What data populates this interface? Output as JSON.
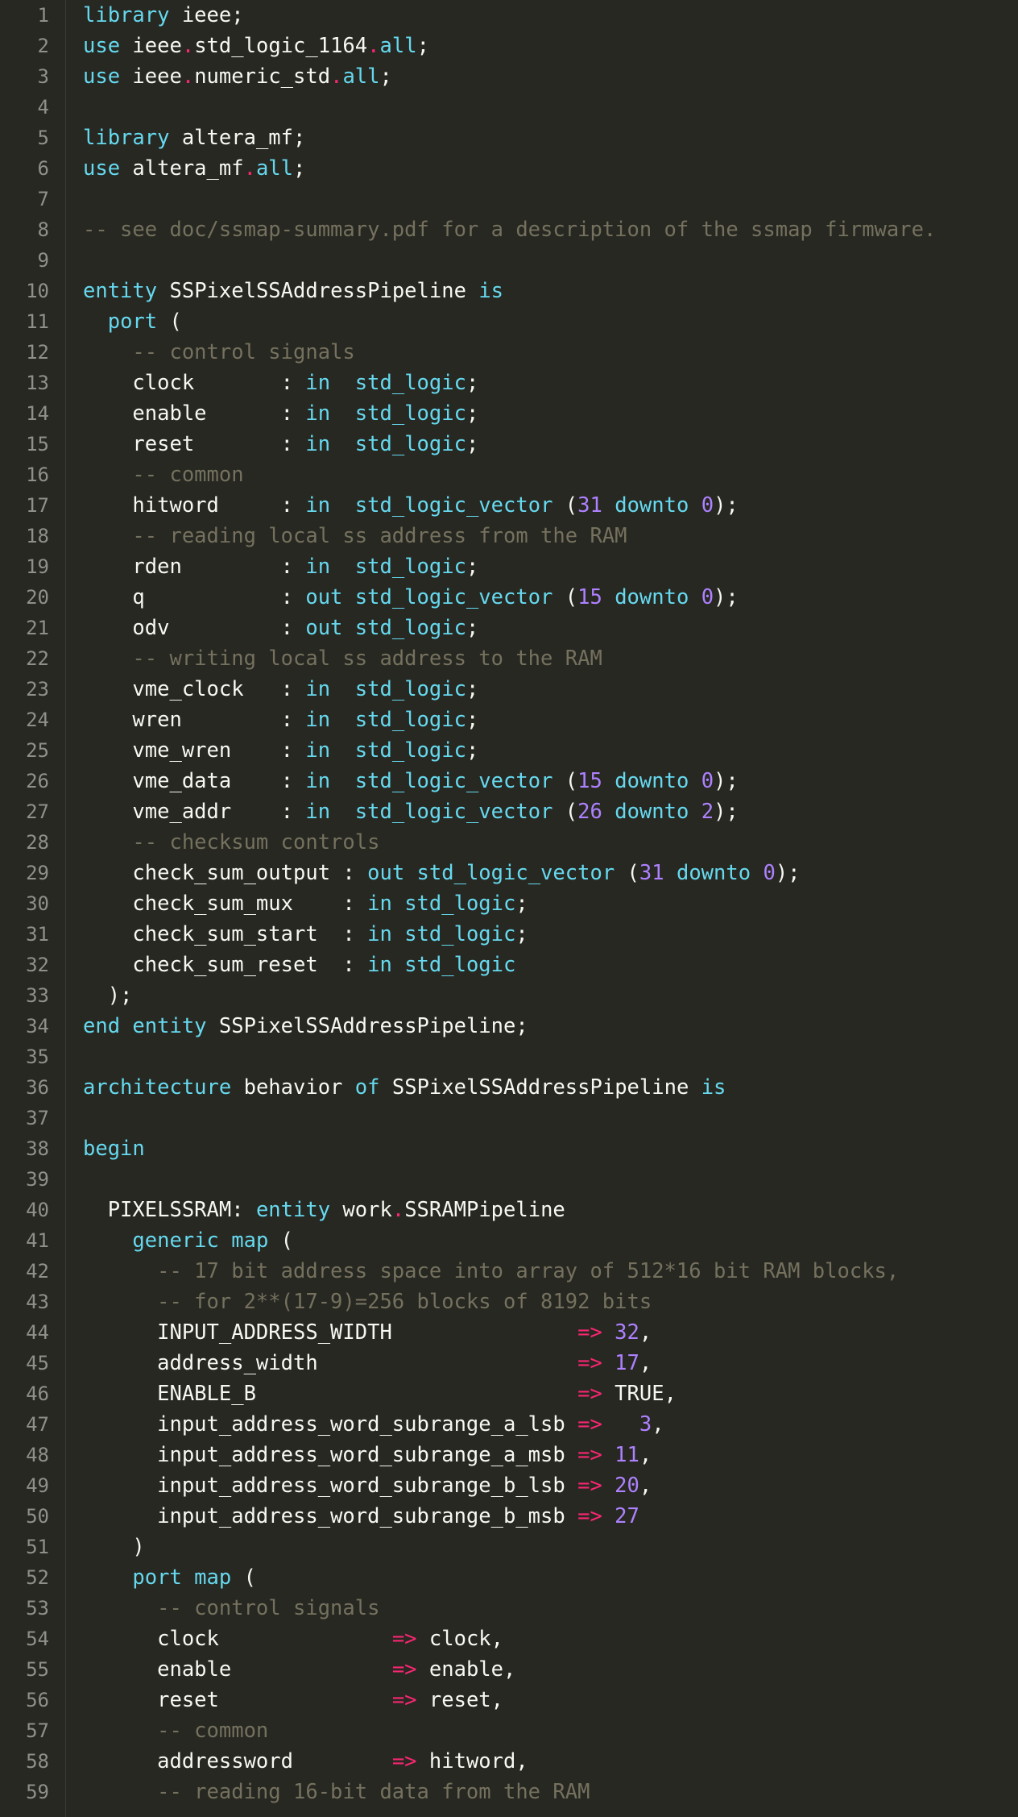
{
  "editor": {
    "colors": {
      "background": "#272822",
      "text": "#f8f8f2",
      "keyword": "#66d9ef",
      "operator": "#f92672",
      "number": "#ae81ff",
      "comment": "#75715e",
      "line_number": "#8f908a"
    },
    "lines": [
      [
        [
          "kw",
          "library"
        ],
        [
          "",
          "ieee;"
        ]
      ],
      [
        [
          "kw",
          "use"
        ],
        [
          "",
          "ieee"
        ],
        [
          "op",
          "."
        ],
        [
          "",
          "std_logic_1164"
        ],
        [
          "op",
          "."
        ],
        [
          "kw",
          "all"
        ],
        [
          "",
          ";"
        ]
      ],
      [
        [
          "kw",
          "use"
        ],
        [
          "",
          "ieee"
        ],
        [
          "op",
          "."
        ],
        [
          "",
          "numeric_std"
        ],
        [
          "op",
          "."
        ],
        [
          "kw",
          "all"
        ],
        [
          "",
          ";"
        ]
      ],
      [],
      [
        [
          "kw",
          "library"
        ],
        [
          "",
          "altera_mf;"
        ]
      ],
      [
        [
          "kw",
          "use"
        ],
        [
          "",
          "altera_mf"
        ],
        [
          "op",
          "."
        ],
        [
          "kw",
          "all"
        ],
        [
          "",
          ";"
        ]
      ],
      [],
      [
        [
          "cm",
          "-- see doc/ssmap-summary.pdf for a description of the ssmap firmware."
        ]
      ],
      [],
      [
        [
          "kw",
          "entity"
        ],
        [
          "",
          "SSPixelSSAddressPipeline"
        ],
        [
          "kw",
          "is"
        ]
      ],
      [
        [
          "",
          "  "
        ],
        [
          "kw",
          "port"
        ],
        [
          "",
          "("
        ]
      ],
      [
        [
          "cm",
          "    -- control signals"
        ]
      ],
      [
        [
          "",
          "    clock       : "
        ],
        [
          "kw",
          "in"
        ],
        [
          "",
          "  "
        ],
        [
          "kw",
          "std_logic"
        ],
        [
          "",
          ";"
        ]
      ],
      [
        [
          "",
          "    enable      : "
        ],
        [
          "kw",
          "in"
        ],
        [
          "",
          "  "
        ],
        [
          "kw",
          "std_logic"
        ],
        [
          "",
          ";"
        ]
      ],
      [
        [
          "",
          "    reset       : "
        ],
        [
          "kw",
          "in"
        ],
        [
          "",
          "  "
        ],
        [
          "kw",
          "std_logic"
        ],
        [
          "",
          ";"
        ]
      ],
      [
        [
          "cm",
          "    -- common"
        ]
      ],
      [
        [
          "",
          "    hitword     : "
        ],
        [
          "kw",
          "in"
        ],
        [
          "",
          "  "
        ],
        [
          "kw",
          "std_logic_vector"
        ],
        [
          "",
          "("
        ],
        [
          "num",
          "31"
        ],
        [
          "kw",
          "downto"
        ],
        [
          "num",
          "0"
        ],
        [
          "",
          ");"
        ]
      ],
      [
        [
          "cm",
          "    -- reading local ss address from the RAM"
        ]
      ],
      [
        [
          "",
          "    rden        : "
        ],
        [
          "kw",
          "in"
        ],
        [
          "",
          "  "
        ],
        [
          "kw",
          "std_logic"
        ],
        [
          "",
          ";"
        ]
      ],
      [
        [
          "",
          "    q           : "
        ],
        [
          "kw",
          "out"
        ],
        [
          "kw",
          "std_logic_vector"
        ],
        [
          "",
          "("
        ],
        [
          "num",
          "15"
        ],
        [
          "kw",
          "downto"
        ],
        [
          "num",
          "0"
        ],
        [
          "",
          ");"
        ]
      ],
      [
        [
          "",
          "    odv         : "
        ],
        [
          "kw",
          "out"
        ],
        [
          "kw",
          "std_logic"
        ],
        [
          "",
          ";"
        ]
      ],
      [
        [
          "cm",
          "    -- writing local ss address to the RAM"
        ]
      ],
      [
        [
          "",
          "    vme_clock   : "
        ],
        [
          "kw",
          "in"
        ],
        [
          "",
          "  "
        ],
        [
          "kw",
          "std_logic"
        ],
        [
          "",
          ";"
        ]
      ],
      [
        [
          "",
          "    wren        : "
        ],
        [
          "kw",
          "in"
        ],
        [
          "",
          "  "
        ],
        [
          "kw",
          "std_logic"
        ],
        [
          "",
          ";"
        ]
      ],
      [
        [
          "",
          "    vme_wren    : "
        ],
        [
          "kw",
          "in"
        ],
        [
          "",
          "  "
        ],
        [
          "kw",
          "std_logic"
        ],
        [
          "",
          ";"
        ]
      ],
      [
        [
          "",
          "    vme_data    : "
        ],
        [
          "kw",
          "in"
        ],
        [
          "",
          "  "
        ],
        [
          "kw",
          "std_logic_vector"
        ],
        [
          "",
          "("
        ],
        [
          "num",
          "15"
        ],
        [
          "kw",
          "downto"
        ],
        [
          "num",
          "0"
        ],
        [
          "",
          ");"
        ]
      ],
      [
        [
          "",
          "    vme_addr    : "
        ],
        [
          "kw",
          "in"
        ],
        [
          "",
          "  "
        ],
        [
          "kw",
          "std_logic_vector"
        ],
        [
          "",
          "("
        ],
        [
          "num",
          "26"
        ],
        [
          "kw",
          "downto"
        ],
        [
          "num",
          "2"
        ],
        [
          "",
          ");"
        ]
      ],
      [
        [
          "cm",
          "    -- checksum controls"
        ]
      ],
      [
        [
          "",
          "    check_sum_output : "
        ],
        [
          "kw",
          "out"
        ],
        [
          "kw",
          "std_logic_vector"
        ],
        [
          "",
          "("
        ],
        [
          "num",
          "31"
        ],
        [
          "kw",
          "downto"
        ],
        [
          "num",
          "0"
        ],
        [
          "",
          ");"
        ]
      ],
      [
        [
          "",
          "    check_sum_mux    : "
        ],
        [
          "kw",
          "in"
        ],
        [
          "kw",
          "std_logic"
        ],
        [
          "",
          ";"
        ]
      ],
      [
        [
          "",
          "    check_sum_start  : "
        ],
        [
          "kw",
          "in"
        ],
        [
          "kw",
          "std_logic"
        ],
        [
          "",
          ";"
        ]
      ],
      [
        [
          "",
          "    check_sum_reset  : "
        ],
        [
          "kw",
          "in"
        ],
        [
          "kw",
          "std_logic"
        ]
      ],
      [
        [
          "",
          "  );"
        ]
      ],
      [
        [
          "kw",
          "end"
        ],
        [
          "kw",
          "entity"
        ],
        [
          "",
          "SSPixelSSAddressPipeline;"
        ]
      ],
      [],
      [
        [
          "kw",
          "architecture"
        ],
        [
          "",
          "behavior"
        ],
        [
          "kw",
          "of"
        ],
        [
          "",
          "SSPixelSSAddressPipeline"
        ],
        [
          "kw",
          "is"
        ]
      ],
      [],
      [
        [
          "kw",
          "begin"
        ]
      ],
      [],
      [
        [
          "",
          "  PIXELSSRAM: "
        ],
        [
          "kw",
          "entity"
        ],
        [
          "",
          "work"
        ],
        [
          "op",
          "."
        ],
        [
          "",
          "SSRAMPipeline"
        ]
      ],
      [
        [
          "",
          "    "
        ],
        [
          "kw",
          "generic map"
        ],
        [
          "",
          "("
        ]
      ],
      [
        [
          "cm",
          "      -- 17 bit address space into array of 512*16 bit RAM blocks,"
        ]
      ],
      [
        [
          "cm",
          "      -- for 2**(17-9)=256 blocks of 8192 bits"
        ]
      ],
      [
        [
          "",
          "      INPUT_ADDRESS_WIDTH               "
        ],
        [
          "op",
          "=>"
        ],
        [
          "num",
          "32"
        ],
        [
          "",
          ","
        ]
      ],
      [
        [
          "",
          "      address_width                     "
        ],
        [
          "op",
          "=>"
        ],
        [
          "num",
          "17"
        ],
        [
          "",
          ","
        ]
      ],
      [
        [
          "",
          "      ENABLE_B                          "
        ],
        [
          "op",
          "=>"
        ],
        [
          "",
          "TRUE,"
        ]
      ],
      [
        [
          "",
          "      input_address_word_subrange_a_lsb "
        ],
        [
          "op",
          "=>"
        ],
        [
          "",
          "  "
        ],
        [
          "num",
          "3"
        ],
        [
          "",
          ","
        ]
      ],
      [
        [
          "",
          "      input_address_word_subrange_a_msb "
        ],
        [
          "op",
          "=>"
        ],
        [
          "num",
          "11"
        ],
        [
          "",
          ","
        ]
      ],
      [
        [
          "",
          "      input_address_word_subrange_b_lsb "
        ],
        [
          "op",
          "=>"
        ],
        [
          "num",
          "20"
        ],
        [
          "",
          ","
        ]
      ],
      [
        [
          "",
          "      input_address_word_subrange_b_msb "
        ],
        [
          "op",
          "=>"
        ],
        [
          "num",
          "27"
        ]
      ],
      [
        [
          "",
          "    )"
        ]
      ],
      [
        [
          "",
          "    "
        ],
        [
          "kw",
          "port map"
        ],
        [
          "",
          "("
        ]
      ],
      [
        [
          "cm",
          "      -- control signals"
        ]
      ],
      [
        [
          "",
          "      clock              "
        ],
        [
          "op",
          "=>"
        ],
        [
          "",
          "clock,"
        ]
      ],
      [
        [
          "",
          "      enable             "
        ],
        [
          "op",
          "=>"
        ],
        [
          "",
          "enable,"
        ]
      ],
      [
        [
          "",
          "      reset              "
        ],
        [
          "op",
          "=>"
        ],
        [
          "",
          "reset,"
        ]
      ],
      [
        [
          "cm",
          "      -- common"
        ]
      ],
      [
        [
          "",
          "      addressword        "
        ],
        [
          "op",
          "=>"
        ],
        [
          "",
          "hitword,"
        ]
      ],
      [
        [
          "cm",
          "      -- reading 16-bit data from the RAM"
        ]
      ]
    ]
  }
}
